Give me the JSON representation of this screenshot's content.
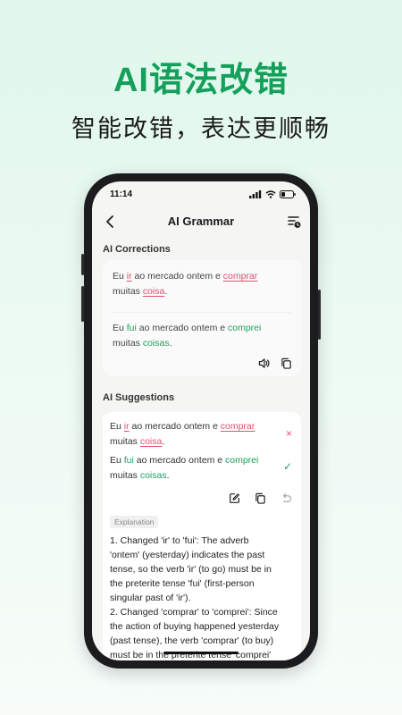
{
  "promo": {
    "title": "AI语法改错",
    "subtitle": "智能改错，表达更顺畅"
  },
  "status_bar": {
    "time": "11:14"
  },
  "nav": {
    "title": "AI Grammar"
  },
  "corrections": {
    "title": "AI Corrections",
    "original": {
      "w1": "Eu ",
      "e1": "ir",
      "w2": " ao mercado ontem e ",
      "e2": "comprar",
      "w3": "muitas ",
      "e3": "coisa",
      "w4": "."
    },
    "corrected": {
      "w1": "Eu ",
      "c1": "fui",
      "w2": " ao mercado ontem e ",
      "c2": "comprei",
      "w3": "muitas ",
      "c3": "coisas",
      "w4": "."
    }
  },
  "suggestions": {
    "title": "AI Suggestions",
    "original": {
      "w1": "Eu ",
      "e1": "ir",
      "w2": " ao mercado ontem e ",
      "e2": "comprar",
      "w3": "muitas ",
      "e3": "coisa",
      "w4": "."
    },
    "corrected": {
      "w1": "Eu ",
      "c1": "fui",
      "w2": " ao mercado ontem e ",
      "c2": "comprei",
      "w3": "muitas ",
      "c3": "coisas",
      "w4": "."
    },
    "reject_mark": "×",
    "accept_mark": "✓",
    "explanation_label": "Explanation",
    "explanation_lines": [
      "1. Changed 'ir' to 'fui': The adverb",
      "'ontem' (yesterday) indicates the past",
      "tense, so the verb 'ir' (to go) must be in",
      "the preterite tense 'fui' (first-person",
      "singular past of 'ir').",
      "2. Changed 'comprar' to 'comprei': Since",
      "the action of buying happened yesterday",
      "(past tense), the verb 'comprar' (to buy)",
      "must be in the preterite tense 'comprei'"
    ]
  },
  "colors": {
    "brand": "#14a05a",
    "error": "#e05070",
    "correct": "#1ea060"
  },
  "icons": [
    "back-icon",
    "history-icon",
    "speaker-icon",
    "copy-icon",
    "edit-icon",
    "undo-icon",
    "close-icon",
    "check-icon"
  ]
}
